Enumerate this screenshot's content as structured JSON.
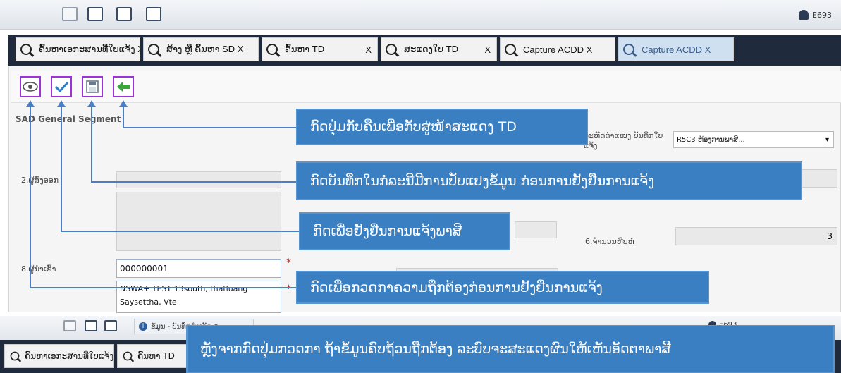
{
  "top_bar": {
    "user_label": "E693"
  },
  "tabs": [
    {
      "label": "ຄົ້ນຫາເອກະສານທີ່ໃບແຈ້ງ X"
    },
    {
      "label": "ສ້າງ ຫຼື ຄົ້ນຫາ SD X"
    },
    {
      "label": "ຄົ້ນຫາ TD"
    },
    {
      "label": "X"
    },
    {
      "label": "ສະແດງໃບ TD"
    },
    {
      "label": "X"
    },
    {
      "label": "Capture ACDD X"
    },
    {
      "label": "Capture ACDD X"
    }
  ],
  "form": {
    "section_title": "SAD General Segment",
    "label_2": "2.ຜູ້ສົ່ງອອກ",
    "label_8": "8.ຜູ້ນໍາເຂົ້າ",
    "importer_code": "000000001",
    "importer_address_1": "NSWA+ TEST 13south, thatluang",
    "importer_address_2": "Saysettha, Vte",
    "right_label": "ລະຫັດຕໍາແໜ່ງ ບັນທຶກໃບແຈ້ງ",
    "right_select_value": "R5C3 ຫ້ອງການພາສີ...",
    "label_6": "6.ຈຳນວນຫີບຫໍ່",
    "value_6": "3"
  },
  "callouts": {
    "back": "ກົດປຸ່ມກັບຄືນເພື່ອກັບສູ່ໜ້າສະແດງ TD",
    "save": "ກົດບັນທຶກໃນກໍລະນີມີການປັບແປງຂໍ້ມູນ ກ່ອນການຢັ້ງຢືນການແຈ້ງ",
    "confirm": "ກົດເພື່ອຢັ້ງຢືນການແຈ້ງພາສີ",
    "check": "ກົດເພື່ອກວດກາຄວາມຖືກຕ້ອງກ່ອນການຢັ້ງຢືນການແຈ້ງ",
    "after": "ຫຼັງຈາກກົດປຸ່ມກວດກາ ຖ້າຂໍ້ມູນຄົບຖ້ວນຖືກຕ້ອງ ລະບົບຈະສະແດງຜົນໃຫ້ເຫັນອັດຕາພາສີ"
  },
  "second_screen": {
    "tab_small": "ຂໍ້ມູນ - ບັນທຶກສຳເລັດ X",
    "user_label": "E693",
    "tab1": "ຄົ້ນຫາເອກະສານທີ່ໃບແຈ້ງ X",
    "tab2": "ຄົ້ນຫາ TD"
  },
  "colors": {
    "accent": "#3a7fc1",
    "tab_bar": "#1f2a3c",
    "highlight": "#9b33d6"
  }
}
